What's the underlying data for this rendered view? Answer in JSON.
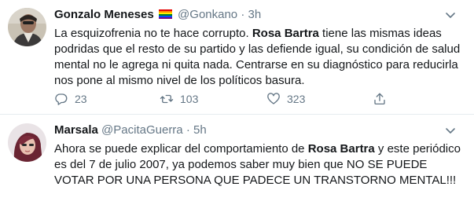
{
  "tweets": [
    {
      "name": "Gonzalo Meneses",
      "handle": "@Gonkano",
      "dot": "·",
      "time": "3h",
      "text_parts": [
        "La esquizofrenia no te hace corrupto. ",
        "Rosa Bartra",
        " tiene las mismas ideas podridas que el resto de su partido y las defiende igual, su condición de salud mental no le agrega ni quita nada. Centrarse en su diagnóstico para reducirla nos pone al mismo nivel de los políticos basura."
      ],
      "replies": "23",
      "retweets": "103",
      "likes": "323"
    },
    {
      "name": "Marsala",
      "handle": "@PacitaGuerra",
      "dot": "·",
      "time": "5h",
      "text_parts": [
        "Ahora se puede explicar del comportamiento de ",
        "Rosa Bartra",
        " y este periódico es del 7 de julio 2007,  ya podemos saber muy bien que NO SE PUEDE VOTAR POR UNA PERSONA QUE PADECE UN TRANSTORNO MENTAL!!!"
      ]
    }
  ],
  "icons": {
    "flag": "rainbow-flag-icon",
    "caret": "chevron-down-icon",
    "reply": "reply-icon",
    "retweet": "retweet-icon",
    "like": "heart-icon",
    "share": "share-icon"
  },
  "colors": {
    "text": "#14171a",
    "secondary": "#657786",
    "divider": "#e6ecf0"
  }
}
